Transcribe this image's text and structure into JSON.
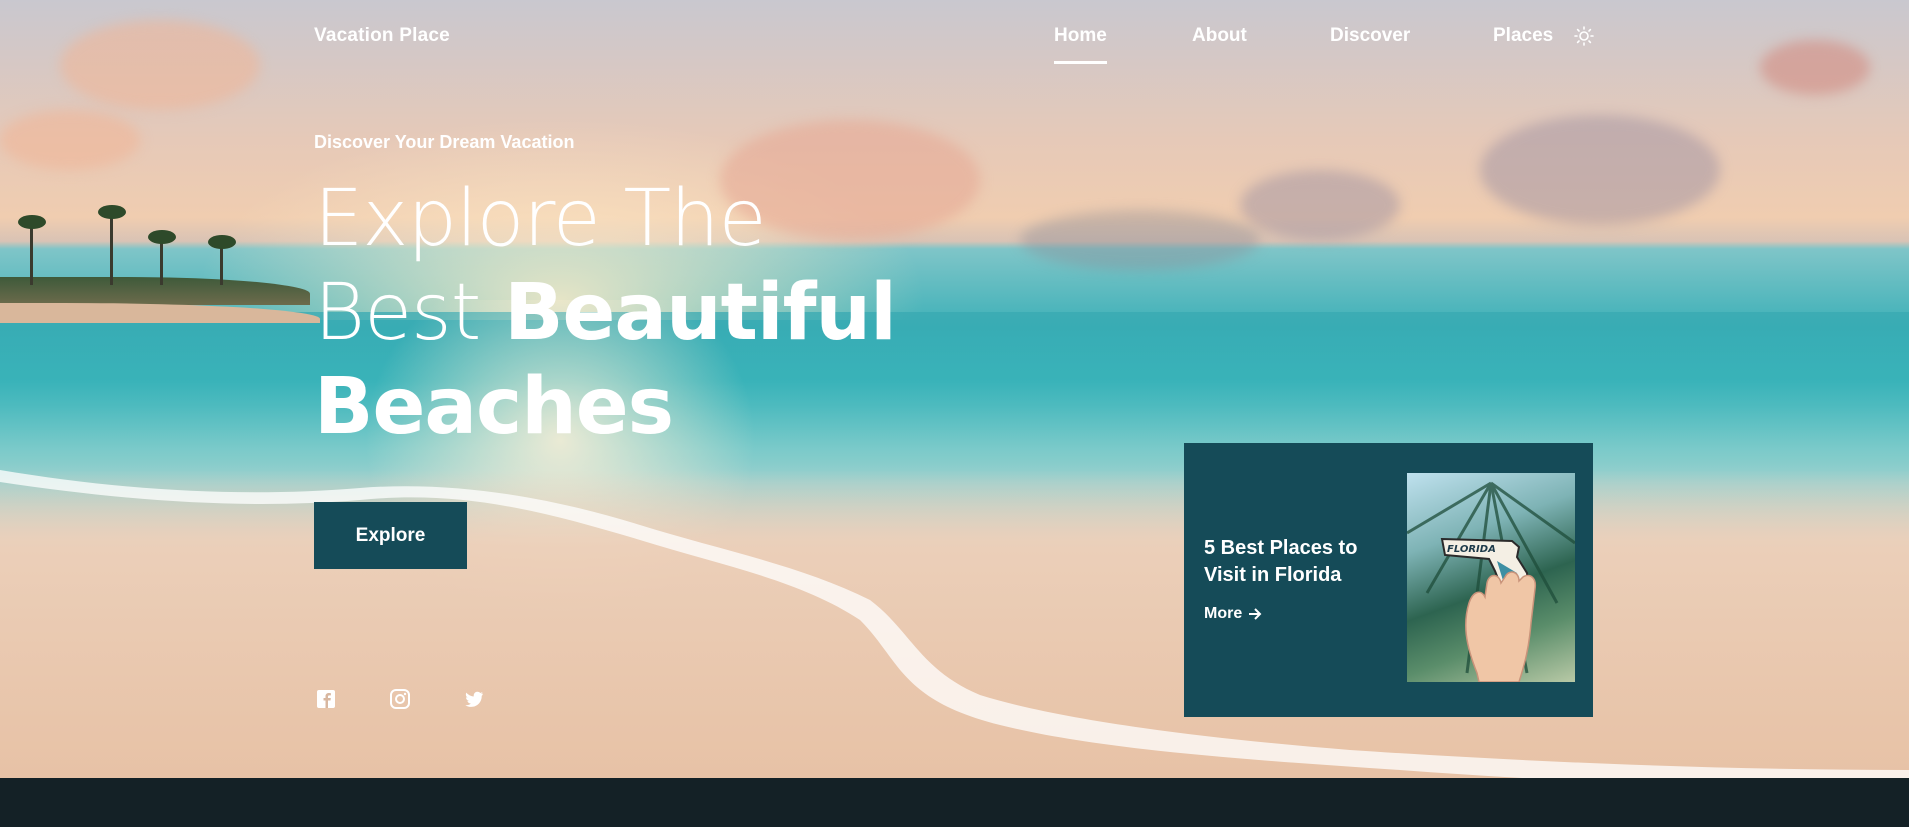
{
  "brand": "Vacation Place",
  "nav": {
    "items": [
      {
        "label": "Home",
        "active": true
      },
      {
        "label": "About",
        "active": false
      },
      {
        "label": "Discover",
        "active": false
      },
      {
        "label": "Places",
        "active": false
      }
    ],
    "theme_toggle_icon": "sun-icon"
  },
  "hero": {
    "eyebrow": "Discover Your Dream Vacation",
    "headline": {
      "line1": "Explore The",
      "line2_light": "Best ",
      "line2_bold": "Beautiful",
      "line3_bold": "Beaches"
    },
    "cta_label": "Explore"
  },
  "social": [
    "facebook-icon",
    "instagram-icon",
    "twitter-icon"
  ],
  "card": {
    "title": "5 Best Places to Visit in Florida",
    "more_label": "More",
    "image_text": "FLORIDA"
  },
  "colors": {
    "accent": "#154b58",
    "footer": "#142126",
    "text": "#ffffff"
  }
}
